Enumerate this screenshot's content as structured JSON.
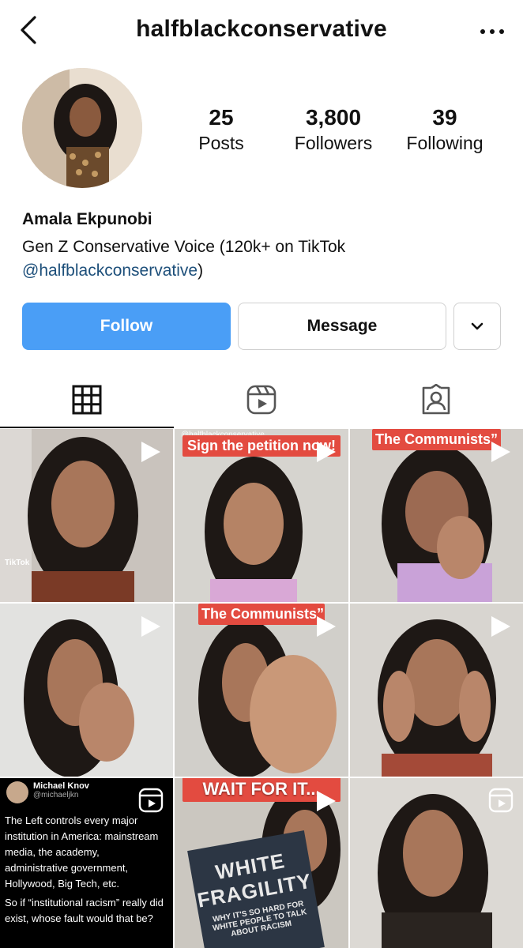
{
  "header": {
    "username": "halfblackconservative"
  },
  "stats": [
    {
      "value": "25",
      "label": "Posts"
    },
    {
      "value": "3,800",
      "label": "Followers"
    },
    {
      "value": "39",
      "label": "Following"
    }
  ],
  "profile": {
    "name": "Amala Ekpunobi",
    "bio_line1": "Gen Z Conservative Voice (120k+ on TikTok",
    "bio_link": "@halfblackconservative",
    "bio_end": ")"
  },
  "actions": {
    "follow": "Follow",
    "message": "Message"
  },
  "tabs": [
    "grid",
    "reels",
    "tagged"
  ],
  "posts": [
    {
      "type": "video",
      "banner": "",
      "extra": "TikTok"
    },
    {
      "type": "video",
      "banner": "Sign the petition now!",
      "extra": "@halfblackconservative"
    },
    {
      "type": "video",
      "banner": "The Communists”",
      "extra": ""
    },
    {
      "type": "video",
      "banner": "",
      "extra": ""
    },
    {
      "type": "video",
      "banner": "The Communists”",
      "extra": ""
    },
    {
      "type": "video",
      "banner": "",
      "extra": ""
    },
    {
      "type": "reel",
      "tweet_author": "Michael Knov",
      "tweet_handle": "@michaeljkn",
      "tweet_text1": "The Left controls every major institution in America: mainstream media, the academy, administrative government, Hollywood, Big Tech, etc.",
      "tweet_text2": "So if “institutional racism” really did exist, whose fault would that be?"
    },
    {
      "type": "video",
      "banner": "WAIT FOR IT...",
      "book_title": "WHITE FRAGILITY",
      "book_sub": "WHY IT'S SO HARD FOR WHITE PEOPLE TO TALK ABOUT RACISM"
    },
    {
      "type": "reel",
      "banner": ""
    }
  ],
  "colors": {
    "follow_bg": "#4a9ef6",
    "link": "#1d4f7a",
    "banner_red": "#e34b40"
  }
}
